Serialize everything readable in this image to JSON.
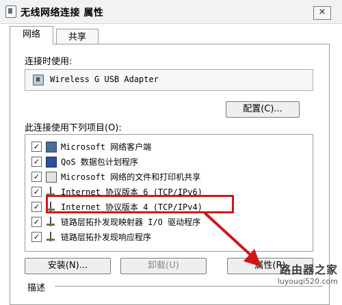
{
  "window": {
    "title": "无线网络连接 属性",
    "close_glyph": "×"
  },
  "tabs": [
    {
      "label": "网络",
      "active": true
    },
    {
      "label": "共享",
      "active": false
    }
  ],
  "connect_label": "连接时使用:",
  "adapter": {
    "name": "Wireless G USB Adapter",
    "icon": "network-adapter-icon"
  },
  "configure_button": "配置(C)...",
  "items_label": "此连接使用下列项目(O):",
  "items": [
    {
      "label": "Microsoft 网络客户端",
      "checked": true,
      "icon": "network-client-icon"
    },
    {
      "label": "QoS 数据包计划程序",
      "checked": true,
      "icon": "qos-icon"
    },
    {
      "label": "Microsoft 网络的文件和打印机共享",
      "checked": true,
      "icon": "file-printer-share-icon"
    },
    {
      "label": "Internet 协议版本 6 (TCP/IPv6)",
      "checked": true,
      "icon": "protocol-icon"
    },
    {
      "label": "Internet 协议版本 4 (TCP/IPv4)",
      "checked": true,
      "icon": "protocol-icon"
    },
    {
      "label": "链路层拓扑发现映射器 I/O 驱动程序",
      "checked": true,
      "icon": "protocol-icon"
    },
    {
      "label": "链路层拓扑发现响应程序",
      "checked": true,
      "icon": "protocol-icon"
    }
  ],
  "check_glyph": "✓",
  "buttons": {
    "install": "安装(N)...",
    "uninstall": "卸载(U)",
    "properties": "属性(R)"
  },
  "description_label": "描述",
  "watermark": {
    "name": "路由器之家",
    "url": "luyouqi520.com"
  },
  "colors": {
    "highlight": "#cf1717"
  }
}
